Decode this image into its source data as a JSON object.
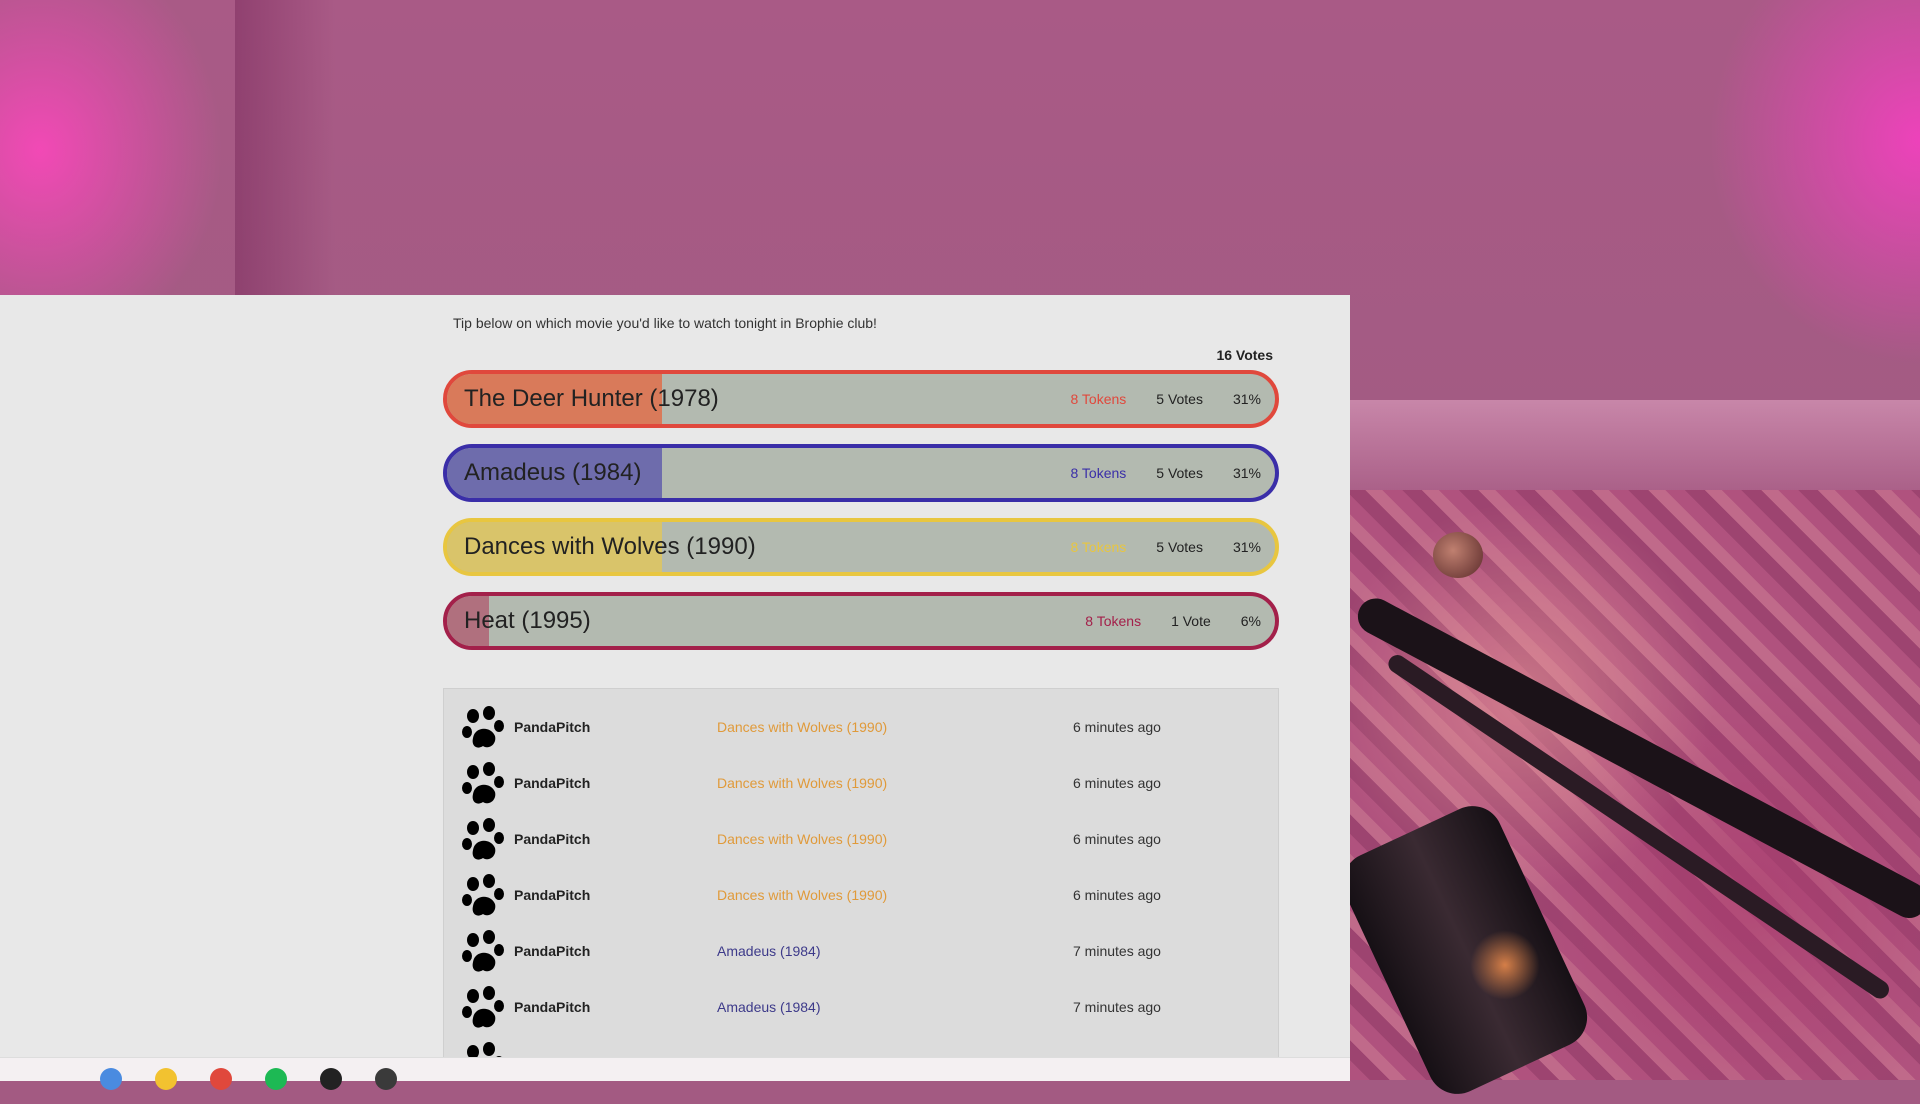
{
  "poll": {
    "intro": "Tip below on which movie you'd like to watch tonight in Brophie club!",
    "total_votes": "16 Votes",
    "options": [
      {
        "title": "The Deer Hunter (1978)",
        "tokens": "8 Tokens",
        "votes": "5 Votes",
        "percent": "31%",
        "share": 0.31,
        "color": "#e0483c",
        "fill": "#d97a5a"
      },
      {
        "title": "Amadeus (1984)",
        "tokens": "8 Tokens",
        "votes": "5 Votes",
        "percent": "31%",
        "share": 0.31,
        "color": "#3a2ea8",
        "fill": "#6e6cac"
      },
      {
        "title": "Dances with Wolves (1990)",
        "tokens": "8 Tokens",
        "votes": "5 Votes",
        "percent": "31%",
        "share": 0.31,
        "color": "#e8c640",
        "fill": "#d9c46a"
      },
      {
        "title": "Heat (1995)",
        "tokens": "8 Tokens",
        "votes": "1 Vote",
        "percent": "6%",
        "share": 0.06,
        "color": "#a3204a",
        "fill": "#b0707e"
      }
    ]
  },
  "feed": {
    "rows": [
      {
        "user": "PandaPitch",
        "movie": "Dances with Wolves (1990)",
        "movie_color": "#e09a3a",
        "time": "6 minutes ago"
      },
      {
        "user": "PandaPitch",
        "movie": "Dances with Wolves (1990)",
        "movie_color": "#e09a3a",
        "time": "6 minutes ago"
      },
      {
        "user": "PandaPitch",
        "movie": "Dances with Wolves (1990)",
        "movie_color": "#e09a3a",
        "time": "6 minutes ago"
      },
      {
        "user": "PandaPitch",
        "movie": "Dances with Wolves (1990)",
        "movie_color": "#e09a3a",
        "time": "6 minutes ago"
      },
      {
        "user": "PandaPitch",
        "movie": "Amadeus (1984)",
        "movie_color": "#3d3a8a",
        "time": "7 minutes ago"
      },
      {
        "user": "PandaPitch",
        "movie": "Amadeus (1984)",
        "movie_color": "#3d3a8a",
        "time": "7 minutes ago"
      }
    ]
  },
  "taskbar": {
    "icons": [
      {
        "name": "copilot-icon",
        "color": "#4a8be0"
      },
      {
        "name": "file-explorer-icon",
        "color": "#f2c230"
      },
      {
        "name": "chrome-icon",
        "color": "#e0483c"
      },
      {
        "name": "spotify-icon",
        "color": "#1db954"
      },
      {
        "name": "app-icon",
        "color": "#222222"
      },
      {
        "name": "obs-icon",
        "color": "#3a3a3a"
      }
    ]
  }
}
